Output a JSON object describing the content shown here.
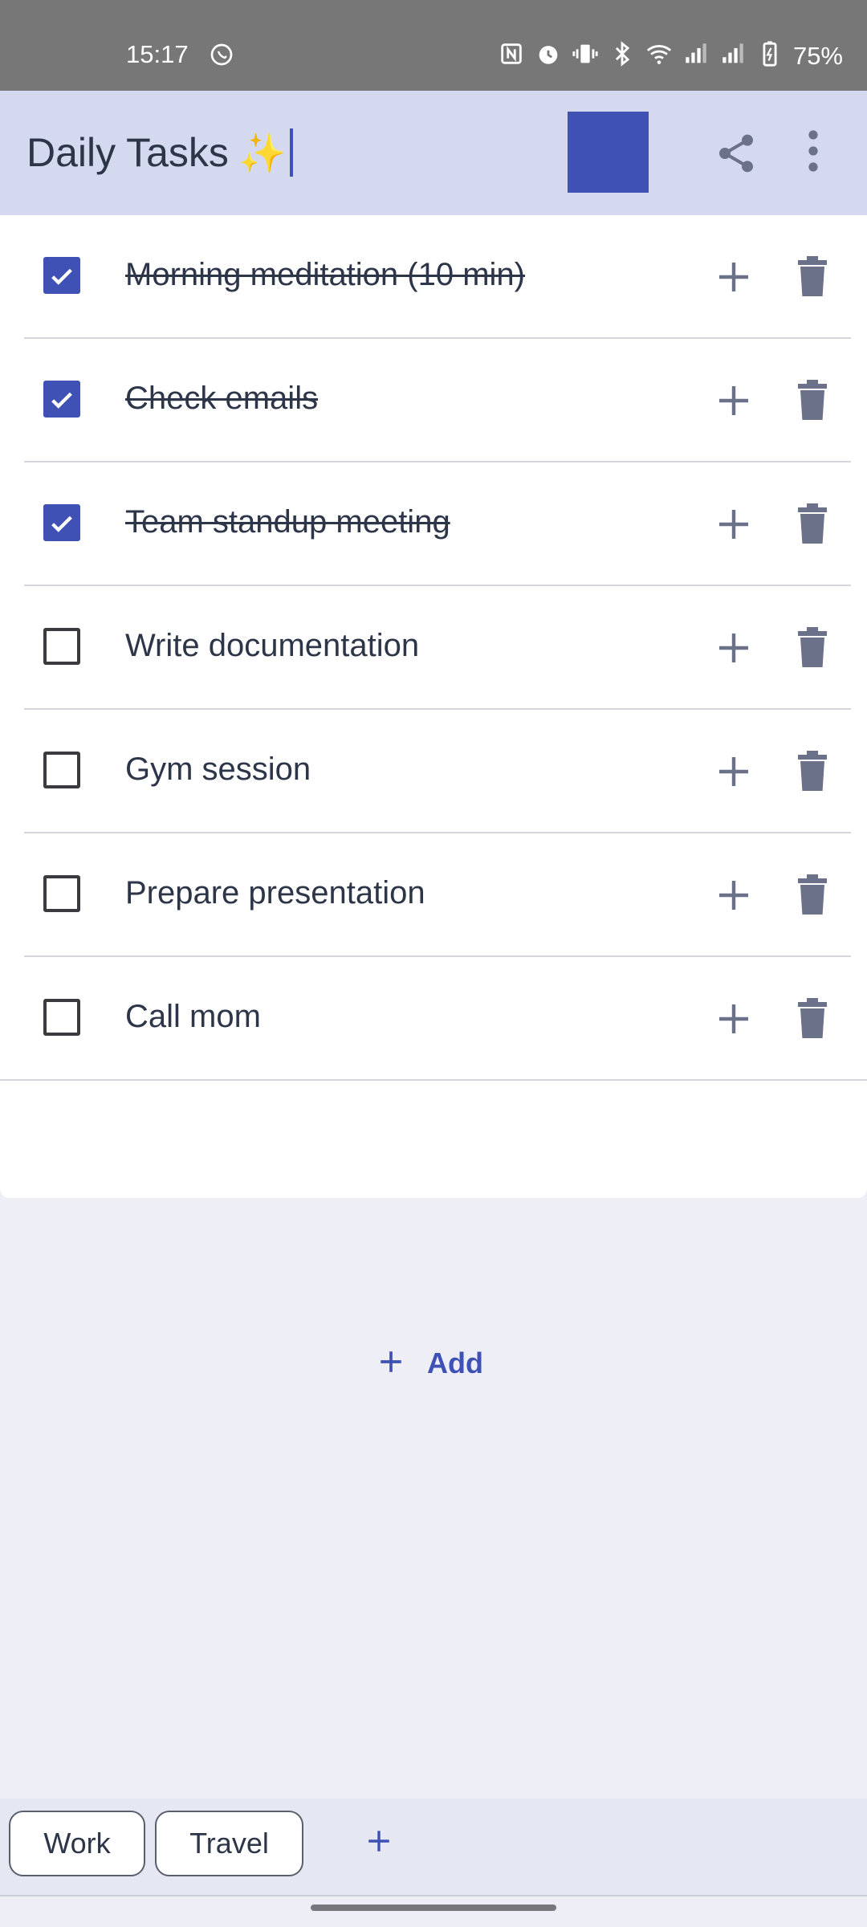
{
  "status_bar": {
    "time": "15:17",
    "battery": "75%",
    "icons": [
      "chat-icon",
      "nfc-icon",
      "alarm-icon",
      "vibrate-icon",
      "bluetooth-icon",
      "wifi-icon",
      "signal-icon",
      "signal-icon",
      "battery-charging-icon"
    ]
  },
  "app_bar": {
    "title": "Daily Tasks",
    "title_emoji": "✨",
    "accent_color": "#3f51b5",
    "actions": [
      "share-icon",
      "more-vert-icon"
    ]
  },
  "tasks": [
    {
      "label": "Morning meditation (10 min)",
      "checked": true
    },
    {
      "label": "Check emails",
      "checked": true
    },
    {
      "label": "Team standup meeting",
      "checked": true
    },
    {
      "label": "Write documentation",
      "checked": false
    },
    {
      "label": "Gym session",
      "checked": false
    },
    {
      "label": "Prepare presentation",
      "checked": false
    },
    {
      "label": "Call mom",
      "checked": false
    }
  ],
  "add_button": {
    "label": "Add",
    "icon": "plus-icon"
  },
  "bottom_tabs": {
    "tabs": [
      "Work",
      "Travel"
    ],
    "add_icon": "plus-icon"
  },
  "colors": {
    "accent": "#3f51b5",
    "app_bar_bg": "#d5d9ef",
    "page_bg": "#eeeff6",
    "icon_gray": "#6b7188",
    "text": "#2d3548"
  }
}
